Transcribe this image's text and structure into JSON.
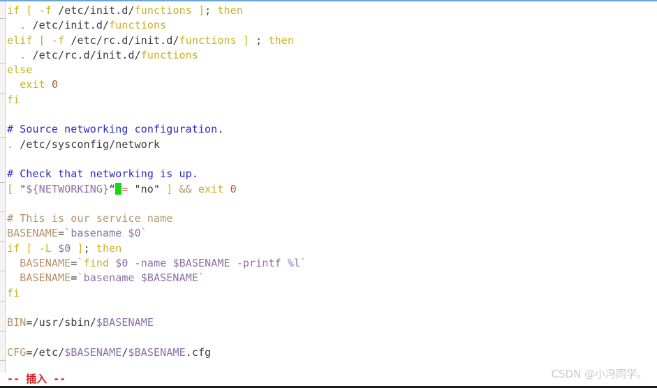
{
  "app": {
    "name": "vim",
    "mode_label": "-- 插入 --",
    "mode_color": "#d81e1e",
    "background": "#ffffff",
    "cursor_color": "#16d916"
  },
  "watermark": {
    "text": "CSDN @小冯同学。",
    "color": "#c9c9c9"
  },
  "palette": {
    "keyword": "#c6b020",
    "comment_blue": "#2a2ac8",
    "comment_tan": "#b4926a",
    "number": "#b5553a",
    "variable": "#8c6fa8",
    "identifier": "#b4926a",
    "plain_text": "#3a3a3a",
    "gutter_bg": "#f4f4f4",
    "top_rule": "#6ba4d8",
    "bottom_rule": "#1c1c1c"
  },
  "gutter": {
    "tick_rows": [
      1,
      4,
      6,
      9,
      12,
      14,
      16,
      18,
      20,
      22,
      24
    ]
  },
  "editor": {
    "lines": [
      {
        "n": 1,
        "text": "if [ -f /etc/init.d/functions ]; then",
        "tokens": [
          {
            "t": "if",
            "c": "kw"
          },
          {
            "t": " ",
            "c": "plain"
          },
          {
            "t": "[",
            "c": "kw"
          },
          {
            "t": " ",
            "c": "plain"
          },
          {
            "t": "-f",
            "c": "kw"
          },
          {
            "t": " /etc/init.d/",
            "c": "plain"
          },
          {
            "t": "functions",
            "c": "kw"
          },
          {
            "t": " ",
            "c": "plain"
          },
          {
            "t": "]",
            "c": "kw"
          },
          {
            "t": "; ",
            "c": "plain"
          },
          {
            "t": "then",
            "c": "kw"
          }
        ]
      },
      {
        "n": 2,
        "text": "  . /etc/init.d/functions",
        "tokens": [
          {
            "t": "  ",
            "c": "plain"
          },
          {
            "t": ".",
            "c": "ident"
          },
          {
            "t": " /etc/init.d/",
            "c": "plain"
          },
          {
            "t": "functions",
            "c": "kw"
          }
        ]
      },
      {
        "n": 3,
        "text": "elif [ -f /etc/rc.d/init.d/functions ] ; then",
        "tokens": [
          {
            "t": "elif",
            "c": "kw"
          },
          {
            "t": " ",
            "c": "plain"
          },
          {
            "t": "[",
            "c": "kw"
          },
          {
            "t": " ",
            "c": "plain"
          },
          {
            "t": "-f",
            "c": "kw"
          },
          {
            "t": " /etc/rc.d/init.d/",
            "c": "plain"
          },
          {
            "t": "functions",
            "c": "kw"
          },
          {
            "t": " ",
            "c": "plain"
          },
          {
            "t": "]",
            "c": "kw"
          },
          {
            "t": " ; ",
            "c": "plain"
          },
          {
            "t": "then",
            "c": "kw"
          }
        ]
      },
      {
        "n": 4,
        "text": "  . /etc/rc.d/init.d/functions",
        "tokens": [
          {
            "t": "  ",
            "c": "plain"
          },
          {
            "t": ".",
            "c": "ident"
          },
          {
            "t": " /etc/rc.d/init.d/",
            "c": "plain"
          },
          {
            "t": "functions",
            "c": "kw"
          }
        ]
      },
      {
        "n": 5,
        "text": "else",
        "tokens": [
          {
            "t": "else",
            "c": "kw"
          }
        ]
      },
      {
        "n": 6,
        "text": "  exit 0",
        "tokens": [
          {
            "t": "  ",
            "c": "plain"
          },
          {
            "t": "exit",
            "c": "kw"
          },
          {
            "t": " ",
            "c": "plain"
          },
          {
            "t": "0",
            "c": "num"
          }
        ]
      },
      {
        "n": 7,
        "text": "fi",
        "tokens": [
          {
            "t": "fi",
            "c": "kw"
          }
        ]
      },
      {
        "n": 8,
        "text": "",
        "tokens": []
      },
      {
        "n": 9,
        "text": "# Source networking configuration.",
        "tokens": [
          {
            "t": "# Source networking configuration.",
            "c": "cmt-b"
          }
        ]
      },
      {
        "n": 10,
        "text": ". /etc/sysconfig/network",
        "tokens": [
          {
            "t": ".",
            "c": "ident"
          },
          {
            "t": " /etc/sysconfig/network",
            "c": "plain"
          }
        ]
      },
      {
        "n": 11,
        "text": "",
        "tokens": []
      },
      {
        "n": 12,
        "text": "# Check that networking is up.",
        "tokens": [
          {
            "t": "# Check that networking is up.",
            "c": "cmt-b"
          }
        ]
      },
      {
        "n": 13,
        "text": "[ \"${NETWORKING}\" = \"no\" ] && exit 0",
        "cursor_after": 1,
        "tokens": [
          {
            "t": "[",
            "c": "kw"
          },
          {
            "t": " ",
            "c": "plain"
          },
          {
            "t": "\"",
            "c": "str"
          },
          {
            "t": "${NETWORKING}",
            "c": "var"
          },
          {
            "t": "“",
            "c": "str"
          },
          {
            "t": "CURSOR",
            "c": "cursor"
          },
          {
            "t": "= ",
            "c": "num"
          },
          {
            "t": "\"no\"",
            "c": "plain"
          },
          {
            "t": " ",
            "c": "plain"
          },
          {
            "t": "]",
            "c": "kw"
          },
          {
            "t": " ",
            "c": "plain"
          },
          {
            "t": "&&",
            "c": "ident"
          },
          {
            "t": " ",
            "c": "plain"
          },
          {
            "t": "exit",
            "c": "kw"
          },
          {
            "t": " ",
            "c": "plain"
          },
          {
            "t": "0",
            "c": "num"
          }
        ]
      },
      {
        "n": 14,
        "text": "",
        "tokens": []
      },
      {
        "n": 15,
        "text": "# This is our service name",
        "tokens": [
          {
            "t": "# This is our service name",
            "c": "cmt-t"
          }
        ]
      },
      {
        "n": 16,
        "text": "BASENAME=`basename $0`",
        "tokens": [
          {
            "t": "BASENAME",
            "c": "ident"
          },
          {
            "t": "=",
            "c": "op"
          },
          {
            "t": "`",
            "c": "tick"
          },
          {
            "t": "basename",
            "c": "var"
          },
          {
            "t": " ",
            "c": "plain"
          },
          {
            "t": "$0",
            "c": "var"
          },
          {
            "t": "`",
            "c": "tick"
          }
        ]
      },
      {
        "n": 17,
        "text": "if [ -L $0 ]; then",
        "tokens": [
          {
            "t": "if",
            "c": "kw"
          },
          {
            "t": " ",
            "c": "plain"
          },
          {
            "t": "[",
            "c": "kw"
          },
          {
            "t": " ",
            "c": "plain"
          },
          {
            "t": "-L",
            "c": "kw"
          },
          {
            "t": " ",
            "c": "plain"
          },
          {
            "t": "$0",
            "c": "var"
          },
          {
            "t": " ",
            "c": "plain"
          },
          {
            "t": "]",
            "c": "kw"
          },
          {
            "t": "; ",
            "c": "plain"
          },
          {
            "t": "then",
            "c": "kw"
          }
        ]
      },
      {
        "n": 18,
        "text": "  BASENAME=`find $0 -name $BASENAME -printf %l`",
        "tokens": [
          {
            "t": "  ",
            "c": "plain"
          },
          {
            "t": "BASENAME",
            "c": "ident"
          },
          {
            "t": "=",
            "c": "op"
          },
          {
            "t": "`",
            "c": "tick"
          },
          {
            "t": "find",
            "c": "kw"
          },
          {
            "t": " ",
            "c": "plain"
          },
          {
            "t": "$0",
            "c": "var"
          },
          {
            "t": " ",
            "c": "plain"
          },
          {
            "t": "-name",
            "c": "var"
          },
          {
            "t": " ",
            "c": "plain"
          },
          {
            "t": "$BASENAME",
            "c": "var"
          },
          {
            "t": " ",
            "c": "plain"
          },
          {
            "t": "-printf",
            "c": "var"
          },
          {
            "t": " ",
            "c": "plain"
          },
          {
            "t": "%l",
            "c": "var"
          },
          {
            "t": "`",
            "c": "tick"
          }
        ]
      },
      {
        "n": 19,
        "text": "  BASENAME=`basename $BASENAME`",
        "tokens": [
          {
            "t": "  ",
            "c": "plain"
          },
          {
            "t": "BASENAME",
            "c": "ident"
          },
          {
            "t": "=",
            "c": "op"
          },
          {
            "t": "`",
            "c": "tick"
          },
          {
            "t": "basename",
            "c": "var"
          },
          {
            "t": " ",
            "c": "plain"
          },
          {
            "t": "$BASENAME",
            "c": "var"
          },
          {
            "t": "`",
            "c": "tick"
          }
        ]
      },
      {
        "n": 20,
        "text": "fi",
        "tokens": [
          {
            "t": "fi",
            "c": "kw"
          }
        ]
      },
      {
        "n": 21,
        "text": "",
        "tokens": []
      },
      {
        "n": 22,
        "text": "BIN=/usr/sbin/$BASENAME",
        "tokens": [
          {
            "t": "BIN",
            "c": "ident"
          },
          {
            "t": "=",
            "c": "op"
          },
          {
            "t": "/usr/sbin/",
            "c": "plain"
          },
          {
            "t": "$BASENAME",
            "c": "var"
          }
        ]
      },
      {
        "n": 23,
        "text": "",
        "tokens": []
      },
      {
        "n": 24,
        "text": "CFG=/etc/$BASENAME/$BASENAME.cfg",
        "tokens": [
          {
            "t": "CFG",
            "c": "ident"
          },
          {
            "t": "=",
            "c": "op"
          },
          {
            "t": "/etc/",
            "c": "plain"
          },
          {
            "t": "$BASENAME",
            "c": "var"
          },
          {
            "t": "/",
            "c": "plain"
          },
          {
            "t": "$BASENAME",
            "c": "var"
          },
          {
            "t": ".cfg",
            "c": "plain"
          }
        ]
      }
    ]
  }
}
